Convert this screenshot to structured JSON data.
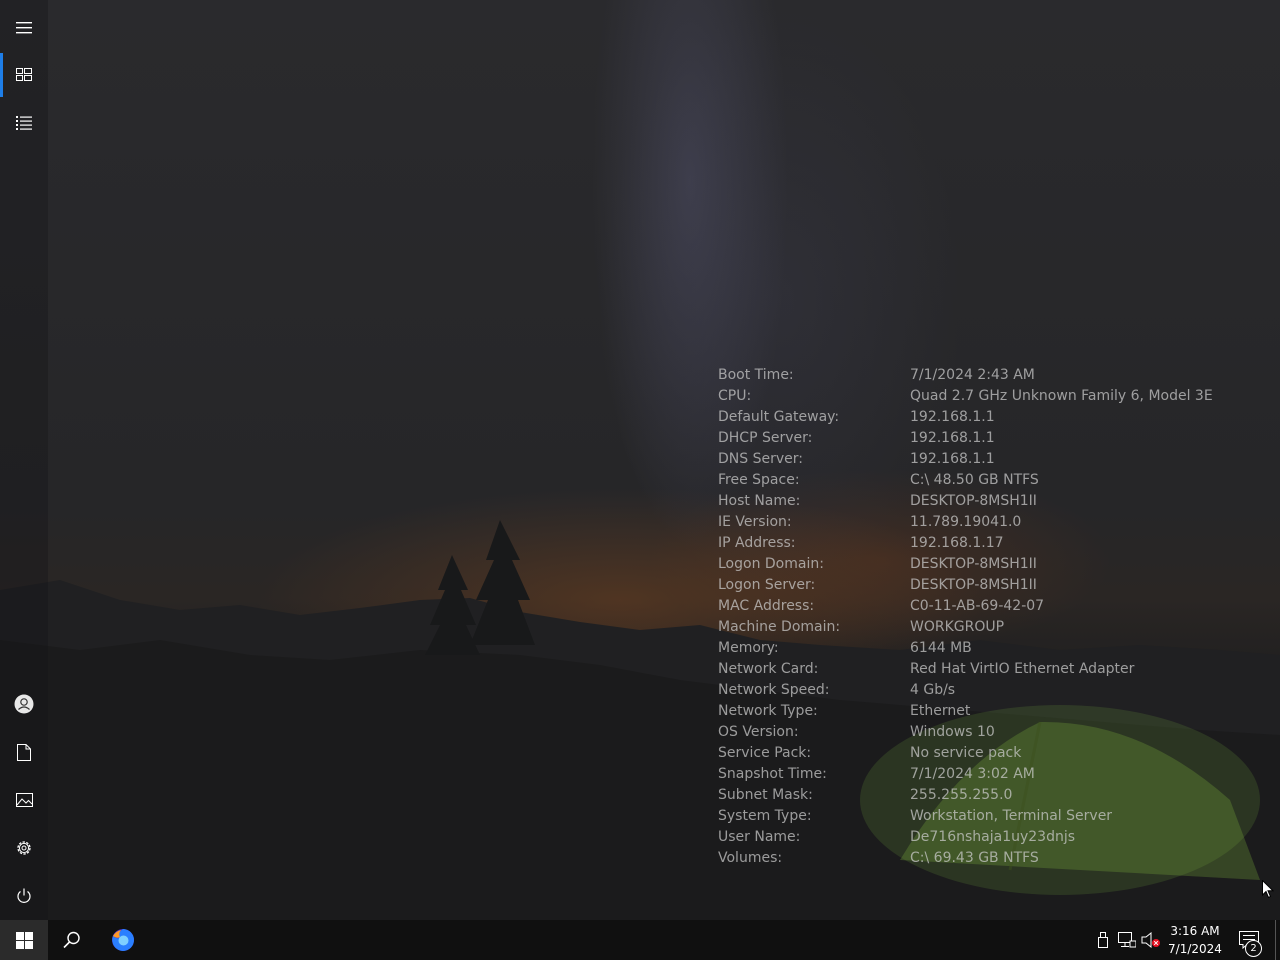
{
  "rail": {
    "items": [
      {
        "name": "menu",
        "icon": "hamburger-menu-icon"
      },
      {
        "name": "tiles",
        "icon": "tiles-icon",
        "active": true
      },
      {
        "name": "all-apps",
        "icon": "list-icon"
      },
      {
        "name": "account",
        "icon": "user-icon"
      },
      {
        "name": "documents",
        "icon": "document-icon"
      },
      {
        "name": "pictures",
        "icon": "picture-icon"
      },
      {
        "name": "settings",
        "icon": "gear-icon"
      },
      {
        "name": "power",
        "icon": "power-icon"
      }
    ]
  },
  "bginfo": {
    "rows": [
      {
        "label": "Boot Time:",
        "value": "7/1/2024 2:43 AM"
      },
      {
        "label": "CPU:",
        "value": "Quad 2.7 GHz Unknown Family 6, Model 3E"
      },
      {
        "label": "Default Gateway:",
        "value": "192.168.1.1"
      },
      {
        "label": "DHCP Server:",
        "value": "192.168.1.1"
      },
      {
        "label": "DNS Server:",
        "value": "192.168.1.1"
      },
      {
        "label": "Free Space:",
        "value": "C:\\ 48.50 GB NTFS"
      },
      {
        "label": "Host Name:",
        "value": "DESKTOP-8MSH1II"
      },
      {
        "label": "IE Version:",
        "value": "11.789.19041.0"
      },
      {
        "label": "IP Address:",
        "value": "192.168.1.17"
      },
      {
        "label": "Logon Domain:",
        "value": "DESKTOP-8MSH1II"
      },
      {
        "label": "Logon Server:",
        "value": "DESKTOP-8MSH1II"
      },
      {
        "label": "MAC Address:",
        "value": "C0-11-AB-69-42-07"
      },
      {
        "label": "Machine Domain:",
        "value": "WORKGROUP"
      },
      {
        "label": "Memory:",
        "value": "6144 MB"
      },
      {
        "label": "Network Card:",
        "value": "Red Hat VirtIO Ethernet Adapter"
      },
      {
        "label": "Network Speed:",
        "value": "4 Gb/s"
      },
      {
        "label": "Network Type:",
        "value": "Ethernet"
      },
      {
        "label": "OS Version:",
        "value": "Windows 10"
      },
      {
        "label": "Service Pack:",
        "value": "No service pack"
      },
      {
        "label": "Snapshot Time:",
        "value": "7/1/2024 3:02 AM"
      },
      {
        "label": "Subnet Mask:",
        "value": "255.255.255.0"
      },
      {
        "label": "System Type:",
        "value": "Workstation, Terminal Server"
      },
      {
        "label": "User Name:",
        "value": "De716nshaja1uy23dnjs"
      },
      {
        "label": "Volumes:",
        "value": "C:\\ 69.43 GB NTFS"
      }
    ]
  },
  "taskbar": {
    "clock_time": "3:16 AM",
    "clock_date": "7/1/2024",
    "notification_count": "2",
    "accent": "#1e7ee8"
  }
}
